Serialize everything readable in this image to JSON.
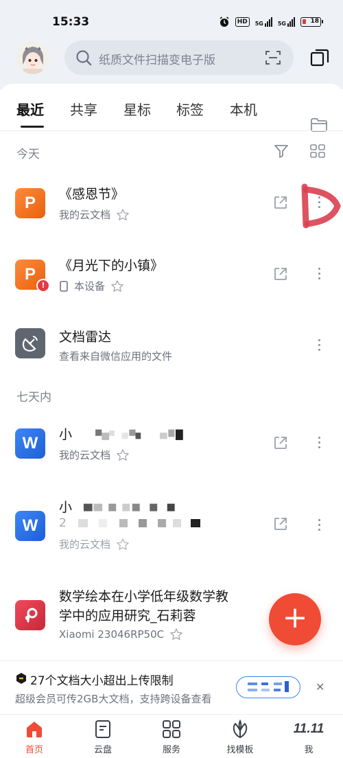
{
  "status_bar": {
    "time": "15:33",
    "hd_label": "HD",
    "net1": "5G",
    "net2": "5G",
    "battery": "18"
  },
  "header": {
    "search_placeholder": "纸质文件扫描变电子版"
  },
  "tabs": [
    {
      "label": "最近",
      "active": true
    },
    {
      "label": "共享",
      "active": false
    },
    {
      "label": "星标",
      "active": false
    },
    {
      "label": "标签",
      "active": false
    },
    {
      "label": "本机",
      "active": false
    }
  ],
  "sections": {
    "today": "今天",
    "week": "七天内"
  },
  "files": [
    {
      "name": "《感恩节》",
      "location": "我的云文档",
      "type": "ppt"
    },
    {
      "name": "《月光下的小镇》",
      "location": "本设备",
      "type": "ppt"
    },
    {
      "name": "文档雷达",
      "location": "查看来自微信应用的文件",
      "type": "radar"
    },
    {
      "name": "小",
      "location": "我的云文档",
      "type": "word"
    },
    {
      "name": "小",
      "line2": "2",
      "location": "我的云文档",
      "type": "word"
    },
    {
      "name_line1": "数学绘本在小学低年级数学教",
      "name_line2": "学中的应用研究_石莉蓉",
      "location": "Xiaomi 23046RP50C",
      "type": "pdf"
    }
  ],
  "icons": {
    "ppt": "P",
    "word": "W",
    "warn": "!"
  },
  "notice": {
    "title": "27个文档大小超出上传限制",
    "subtitle": "超级会员可传2GB大文档，支持跨设备查看",
    "close": "✕"
  },
  "fab_label": "+",
  "bottom_nav": [
    {
      "label": "首页",
      "active": true
    },
    {
      "label": "云盘",
      "active": false
    },
    {
      "label": "服务",
      "active": false
    },
    {
      "label": "找模板",
      "active": false
    },
    {
      "label": "我",
      "active": false
    }
  ],
  "me_badge": "11.11",
  "colors": {
    "accent": "#ef4b35",
    "ppt": "#f07a26",
    "word": "#2f74ea",
    "pdf": "#e0384b",
    "link_blue": "#3b82f6"
  }
}
